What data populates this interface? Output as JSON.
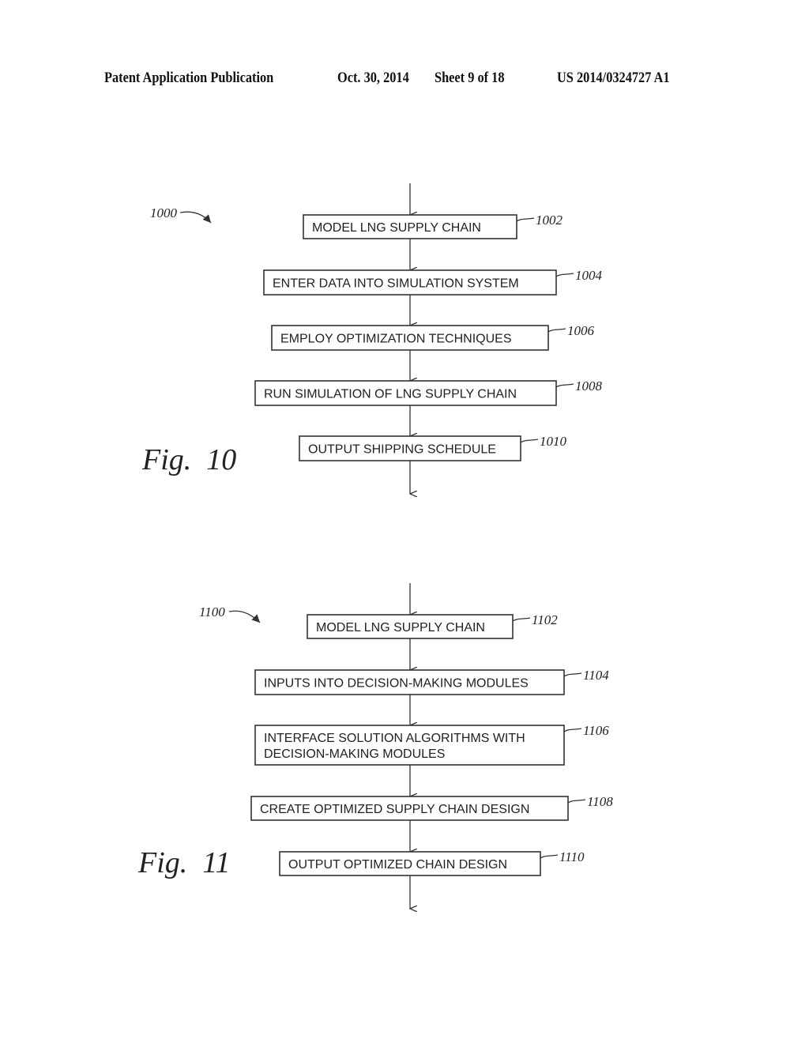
{
  "header": {
    "publication": "Patent Application Publication",
    "date": "Oct. 30, 2014",
    "sheet": "Sheet 9 of 18",
    "number": "US 2014/0324727 A1"
  },
  "figures": [
    {
      "id": "fig10",
      "label": "Fig.  10",
      "ref": "1000",
      "steps": [
        {
          "ref": "1002",
          "lines": [
            "MODEL LNG SUPPLY CHAIN"
          ]
        },
        {
          "ref": "1004",
          "lines": [
            "ENTER DATA INTO SIMULATION SYSTEM"
          ]
        },
        {
          "ref": "1006",
          "lines": [
            "EMPLOY OPTIMIZATION TECHNIQUES"
          ]
        },
        {
          "ref": "1008",
          "lines": [
            "RUN SIMULATION OF LNG SUPPLY CHAIN"
          ]
        },
        {
          "ref": "1010",
          "lines": [
            "OUTPUT SHIPPING SCHEDULE"
          ]
        }
      ]
    },
    {
      "id": "fig11",
      "label": "Fig.  11",
      "ref": "1100",
      "steps": [
        {
          "ref": "1102",
          "lines": [
            "MODEL LNG SUPPLY CHAIN"
          ]
        },
        {
          "ref": "1104",
          "lines": [
            "INPUTS INTO DECISION-MAKING MODULES"
          ]
        },
        {
          "ref": "1106",
          "lines": [
            "INTERFACE SOLUTION ALGORITHMS WITH",
            "DECISION-MAKING MODULES"
          ]
        },
        {
          "ref": "1108",
          "lines": [
            "CREATE OPTIMIZED SUPPLY CHAIN DESIGN"
          ]
        },
        {
          "ref": "1110",
          "lines": [
            "OUTPUT OPTIMIZED CHAIN DESIGN"
          ]
        }
      ]
    }
  ]
}
